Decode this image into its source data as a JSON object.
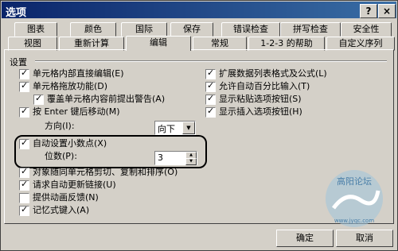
{
  "window": {
    "title": "选项",
    "help_label": "?",
    "close_label": "×"
  },
  "tabs_row1": [
    "图表",
    "颜色",
    "国际",
    "保存",
    "错误检查",
    "拼写检查",
    "安全性"
  ],
  "tabs_row2": [
    "视图",
    "重新计算",
    "编辑",
    "常规",
    "1-2-3 的帮助",
    "自定义序列"
  ],
  "active_tab": "编辑",
  "group_label": "设置",
  "left_options": [
    {
      "label": "单元格内部直接编辑(E)",
      "checked": true
    },
    {
      "label": "单元格拖放功能(D)",
      "checked": true
    },
    {
      "label": "覆盖单元格内容前提出警告(A)",
      "checked": true
    },
    {
      "label": "按 Enter 键后移动(M)",
      "checked": true
    }
  ],
  "direction": {
    "label": "方向(I):",
    "value": "向下"
  },
  "auto_decimal": {
    "label": "自动设置小数点(X)",
    "checked": true
  },
  "places": {
    "label": "位数(P):",
    "value": "3"
  },
  "left_options2": [
    {
      "label": "对象随同单元格剪切、复制和排序(O)",
      "checked": true
    },
    {
      "label": "请求自动更新链接(U)",
      "checked": true
    },
    {
      "label": "提供动画反馈(N)",
      "checked": false
    },
    {
      "label": "记忆式键入(A)",
      "checked": true
    }
  ],
  "right_options": [
    {
      "label": "扩展数据列表格式及公式(L)",
      "checked": true
    },
    {
      "label": "允许自动百分比输入(T)",
      "checked": true
    },
    {
      "label": "显示粘贴选项按钮(S)",
      "checked": true
    },
    {
      "label": "显示插入选项按钮(H)",
      "checked": true
    }
  ],
  "buttons": {
    "ok": "确定",
    "cancel": "取消"
  },
  "watermark": {
    "text1": "高阳论坛",
    "text2": "www.jyqc.com"
  }
}
